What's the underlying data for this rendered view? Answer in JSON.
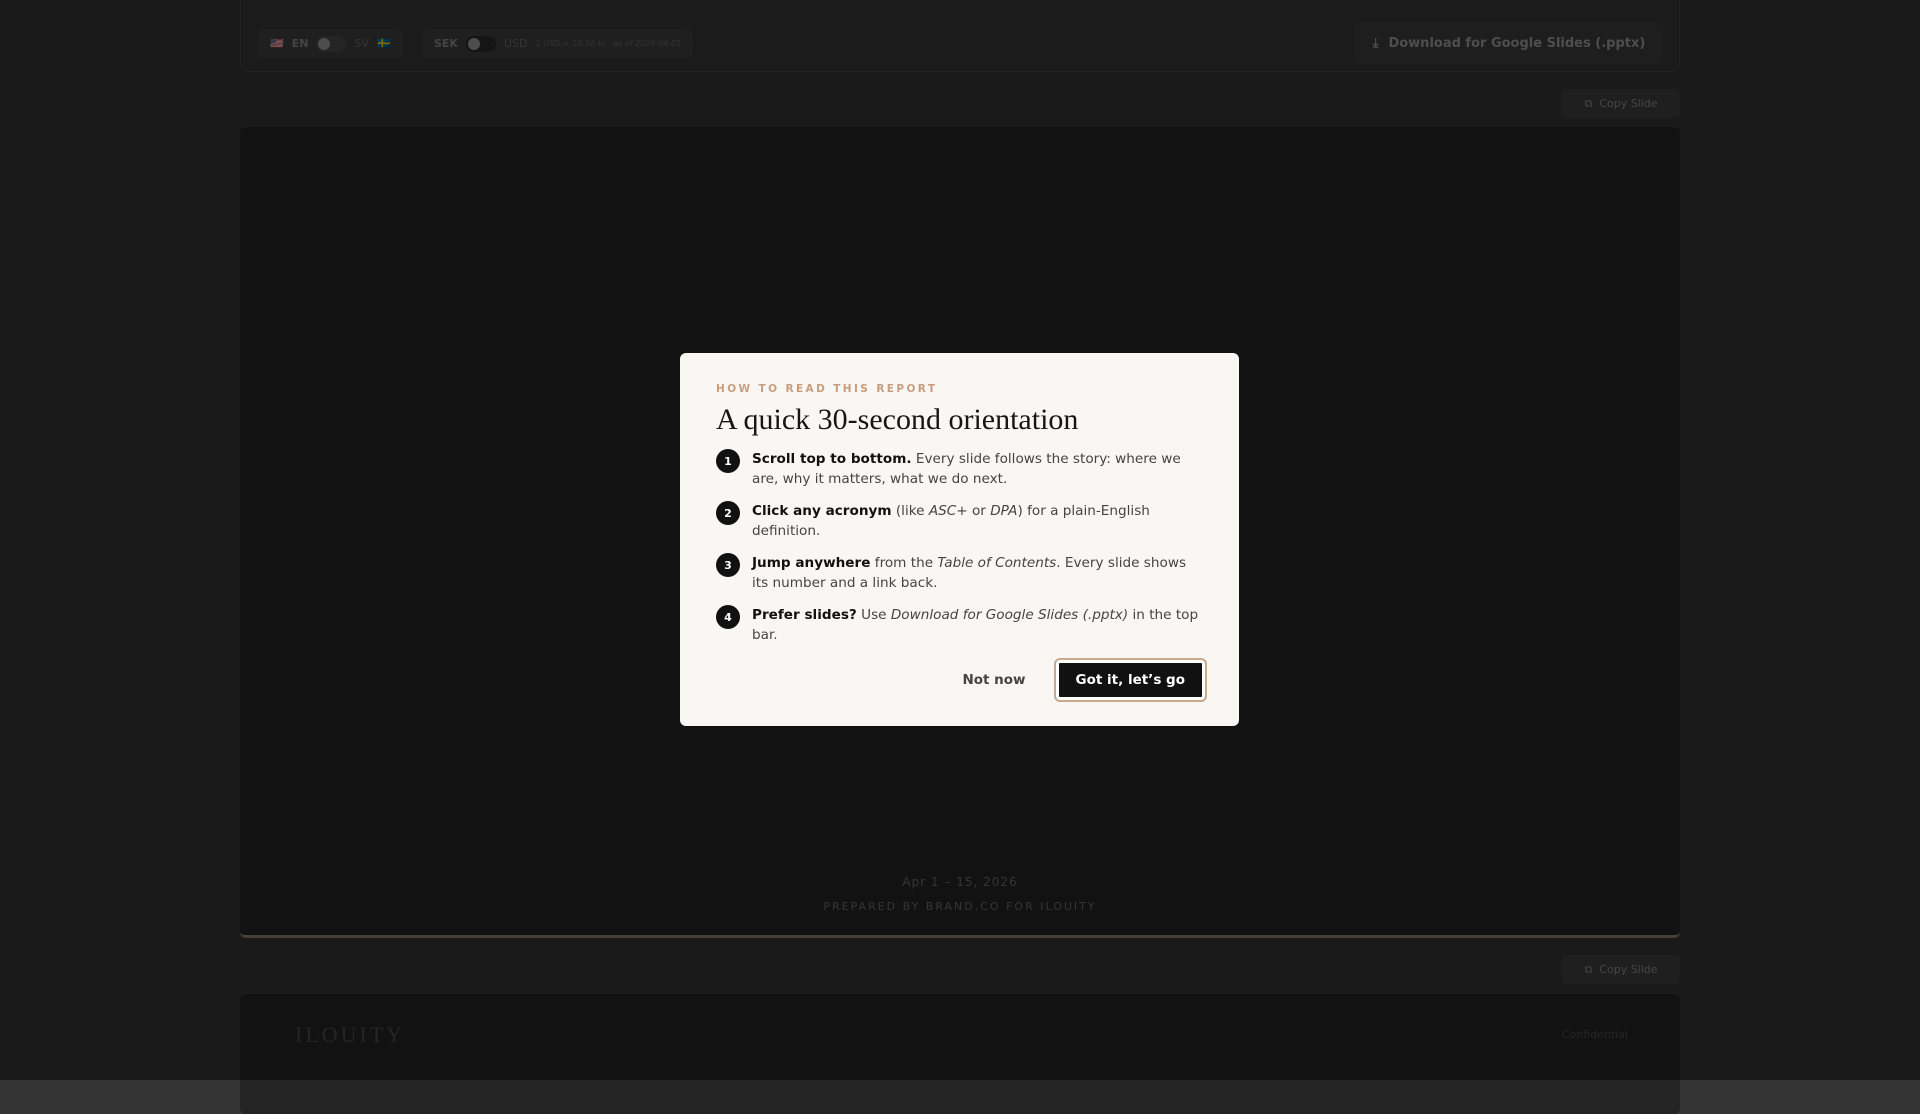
{
  "topbar": {
    "lang_left": "EN",
    "lang_right": "SV",
    "currency_left": "SEK",
    "currency_right": "USD",
    "rate_note": "1 USD = 10.50 kr · as of 2026-04-01",
    "download_label": "Download for Google Slides (.pptx)"
  },
  "copy_slide_label": "Copy Slide",
  "slide1": {
    "date": "Apr 1 – 15, 2026",
    "prepared_by": "PREPARED BY BRAND.CO FOR ILOUITY"
  },
  "slide2": {
    "logo": "ILOUITY",
    "confidential": "Confidential"
  },
  "modal": {
    "kicker": "HOW TO READ THIS REPORT",
    "title": "A quick 30-second orientation",
    "items": [
      {
        "num": "1",
        "bold": "Scroll top to bottom.",
        "a": " Every slide follows the story: where we are, why it matters, what we do next.",
        "i": "",
        "b": ""
      },
      {
        "num": "2",
        "bold": "Click any acronym",
        "a": " (like ",
        "i": "ASC+",
        "b": " or ",
        "i2": "DPA",
        "c": ") for a plain-English definition."
      },
      {
        "num": "3",
        "bold": "Jump anywhere",
        "a": " from the ",
        "i": "Table of Contents",
        "b": ". Every slide shows its number and a link back."
      },
      {
        "num": "4",
        "bold": "Prefer slides?",
        "a": " Use ",
        "i": "Download for Google Slides (.pptx)",
        "b": " in the top bar."
      }
    ],
    "not_now": "Not now",
    "got_it": "Got it, let’s go"
  }
}
